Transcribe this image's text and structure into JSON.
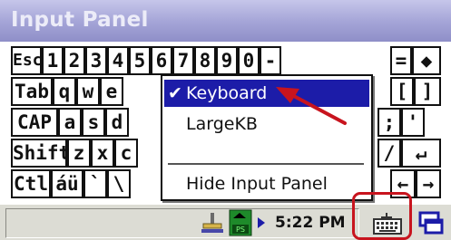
{
  "window": {
    "title": "Input Panel"
  },
  "keyboard": {
    "row1": [
      "Esc",
      "1",
      "2",
      "3",
      "4",
      "5",
      "6",
      "7",
      "8",
      "9",
      "0",
      "-",
      "=",
      "◆"
    ],
    "row2": [
      "Tab",
      "q",
      "w",
      "e",
      "[",
      "]"
    ],
    "row3": [
      "CAP",
      "a",
      "s",
      "d",
      ";",
      "'"
    ],
    "row4": [
      "Shift",
      "z",
      "x",
      "c",
      "/",
      "↵"
    ],
    "row5": [
      "Ctl",
      "áü",
      "`",
      "\\",
      "←",
      "→"
    ]
  },
  "sip_menu": {
    "items": [
      {
        "label": "Keyboard",
        "checked": true,
        "check_glyph": "✔"
      },
      {
        "label": "LargeKB",
        "checked": false
      },
      {
        "label": "Hide Input Panel",
        "checked": false
      }
    ]
  },
  "taskbar": {
    "clock": "5:22 PM",
    "tray_icons": [
      "network-connection-icon",
      "activesync-icon",
      "tray-expand-icon"
    ],
    "sip_button": "keyboard-icon",
    "desktop_button": "windows-icon"
  },
  "colors": {
    "title_bar": "#a6a6d8",
    "menu_highlight": "#1c1ca8",
    "annotation": "#c8141e",
    "taskbar": "#dcdcd4"
  }
}
